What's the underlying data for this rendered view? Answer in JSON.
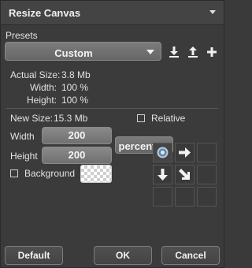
{
  "panel": {
    "title": "Resize Canvas"
  },
  "presets": {
    "label": "Presets",
    "selected": "Custom",
    "icons": [
      "download-icon",
      "upload-icon",
      "plus-icon"
    ]
  },
  "actual": {
    "size_label": "Actual Size:",
    "size_value": "3.8 Mb",
    "width_label": "Width:",
    "width_value": "100 %",
    "height_label": "Height:",
    "height_value": "100 %"
  },
  "new": {
    "size_label": "New Size:",
    "size_value": "15.3 Mb",
    "relative_label": "Relative",
    "width_label": "Width",
    "width_value": "200",
    "height_label": "Height",
    "height_value": "200",
    "unit": "percent",
    "background_label": "Background"
  },
  "anchor": {
    "icons": [
      "target-icon",
      "arrow-right-icon",
      "arrow-down-icon",
      "arrow-down-right-icon"
    ]
  },
  "buttons": {
    "default": "Default",
    "ok": "OK",
    "cancel": "Cancel"
  },
  "colors": {
    "panel_bg": "#3b3b3b",
    "field_bg": "#7a7a7a",
    "text": "#e6e6e6",
    "accent_blue": "#7fa9d6"
  }
}
